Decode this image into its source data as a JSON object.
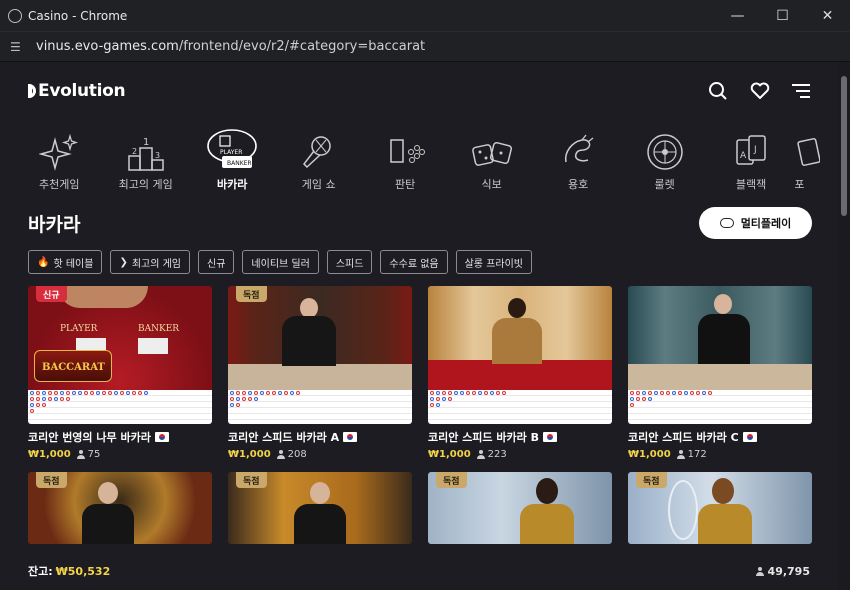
{
  "window": {
    "title": "Casino - Chrome"
  },
  "address": {
    "url_host": "vinus.evo-games.com",
    "url_path": "/frontend/evo/r2/#category=baccarat"
  },
  "brand": {
    "name": "Evolution"
  },
  "categories": [
    {
      "label": "추천게임",
      "icon": "sparkles-icon"
    },
    {
      "label": "최고의 게임",
      "icon": "podium-icon"
    },
    {
      "label": "바카라",
      "icon": "baccarat-cards-icon",
      "active": true
    },
    {
      "label": "게임 쇼",
      "icon": "microphone-icon"
    },
    {
      "label": "판탄",
      "icon": "fantan-icon"
    },
    {
      "label": "식보",
      "icon": "dice-icon"
    },
    {
      "label": "용호",
      "icon": "dragon-icon"
    },
    {
      "label": "룰렛",
      "icon": "roulette-icon"
    },
    {
      "label": "블랙잭",
      "icon": "blackjack-cards-icon"
    },
    {
      "label": "포",
      "icon": "poker-icon"
    }
  ],
  "section": {
    "title": "바카라",
    "multiplay_label": "멀티플레이"
  },
  "filters": [
    {
      "label": "핫 테이블",
      "icon": "flame-icon"
    },
    {
      "label": "최고의 게임",
      "icon": "evolution-icon"
    },
    {
      "label": "신규"
    },
    {
      "label": "네이티브 딜러"
    },
    {
      "label": "스피드"
    },
    {
      "label": "수수료 없음"
    },
    {
      "label": "살롱 프라이빗"
    }
  ],
  "cards": [
    {
      "badge": "신규",
      "badge_type": "new",
      "title": "코리안 번영의 나무 바카라",
      "price": "₩1,000",
      "players": "75"
    },
    {
      "badge": "독점",
      "badge_type": "exclusive",
      "title": "코리안 스피드 바카라 A",
      "price": "₩1,000",
      "players": "208"
    },
    {
      "badge": "독점",
      "badge_type": "exclusive",
      "title": "코리안 스피드 바카라 B",
      "price": "₩1,000",
      "players": "223"
    },
    {
      "badge": "독점",
      "badge_type": "exclusive",
      "title": "코리안 스피드 바카라 C",
      "price": "₩1,000",
      "players": "172"
    }
  ],
  "cards_row2": [
    {
      "badge": "독점"
    },
    {
      "badge": "독점"
    },
    {
      "badge": "독점"
    },
    {
      "badge": "독점"
    }
  ],
  "table_labels": {
    "player": "PLAYER",
    "banker": "BANKER",
    "game_logo": "BACCARAT"
  },
  "footer": {
    "balance_label": "잔고:",
    "balance": "₩50,532",
    "total_players": "49,795"
  },
  "colors": {
    "background": "#1c1c22",
    "accent_gold": "#f3d34a",
    "new_badge": "#d72d3c",
    "exclusive_badge": "#c9a86a"
  }
}
